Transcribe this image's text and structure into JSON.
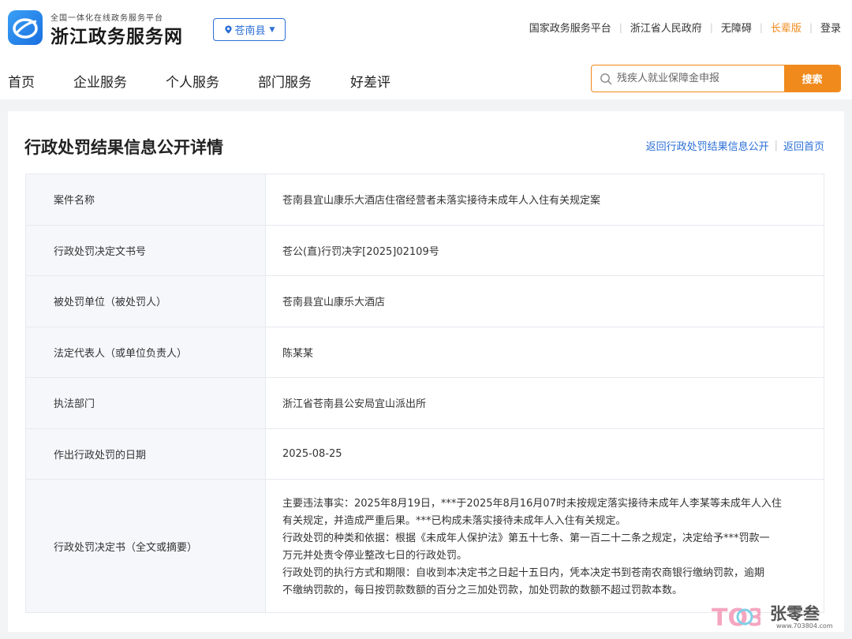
{
  "header": {
    "logo_subtitle": "全国一体化在线政务服务平台",
    "logo_title": "浙江政务服务网",
    "region": "苍南县",
    "top_links": [
      "国家政务服务平台",
      "浙江省人民政府",
      "无障碍",
      "长辈版",
      "登录"
    ]
  },
  "nav": {
    "items": [
      "首页",
      "企业服务",
      "个人服务",
      "部门服务",
      "好差评"
    ]
  },
  "search": {
    "placeholder": "残疾人就业保障金申报",
    "button": "搜索"
  },
  "panel": {
    "title": "行政处罚结果信息公开详情",
    "link_back_list": "返回行政处罚结果信息公开",
    "link_back_home": "返回首页"
  },
  "details": [
    {
      "label": "案件名称",
      "value": "苍南县宜山康乐大酒店住宿经营者未落实接待未成年人入住有关规定案"
    },
    {
      "label": "行政处罚决定文书号",
      "value": "苍公(直)行罚决字[2025]02109号"
    },
    {
      "label": "被处罚单位（被处罚人）",
      "value": "苍南县宜山康乐大酒店"
    },
    {
      "label": "法定代表人（或单位负责人）",
      "value": "陈某某"
    },
    {
      "label": "执法部门",
      "value": "浙江省苍南县公安局宜山派出所"
    },
    {
      "label": "作出行政处罚的日期",
      "value": "2025-08-25"
    }
  ],
  "decision": {
    "label": "行政处罚决定书（全文或摘要）",
    "lines": [
      "主要违法事实：2025年8月19日，***于2025年8月16月07时未按规定落实接待未成年人李某等未成年人入住",
      "有关规定，并造成严重后果。***已构成未落实接待未成年人入住有关规定。",
      "行政处罚的种类和依据：根据《未成年人保护法》第五十七条、第一百二十二条之规定，决定给予***罚款一",
      "万元并处责令停业整改七日的行政处罚。",
      "行政处罚的执行方式和期限：自收到本决定书之日起十五日内，凭本决定书到苍南农商银行缴纳罚款，逾期",
      "不缴纳罚款的，每日按罚款数额的百分之三加处罚款，加处罚款的数额不超过罚款本数。"
    ]
  },
  "watermark": {
    "mark": "TO3",
    "name": "张零叁",
    "url": "www.703804.com"
  },
  "colors": {
    "brand_blue": "#2b6fd6",
    "accent_orange": "#f08a1c"
  }
}
